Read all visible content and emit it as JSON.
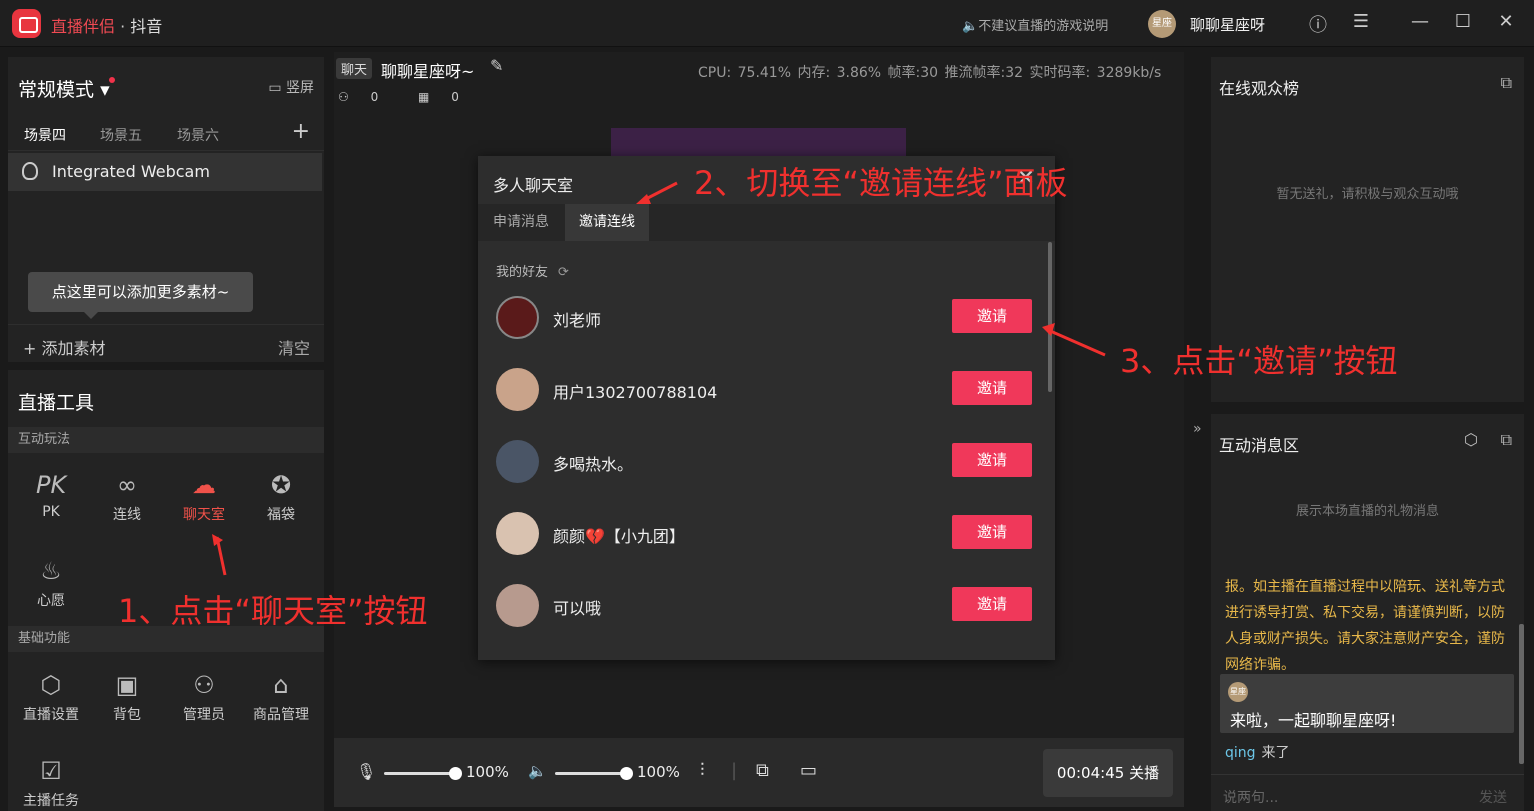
{
  "titlebar": {
    "app_brand": "直播伴侣",
    "app_sep": "·",
    "app_platform": "抖音",
    "game_hint": "不建议直播的游戏说明",
    "user_avatar_text": "星座",
    "username": "聊聊星座呀"
  },
  "mode": {
    "title": "常规模式",
    "vertical_label": "竖屏",
    "scenes": [
      "场景四",
      "场景五",
      "场景六"
    ],
    "source": "Integrated Webcam",
    "tooltip": "点这里可以添加更多素材~",
    "add_material": "添加素材",
    "clear": "清空"
  },
  "tools": {
    "title": "直播工具",
    "section_interactive": "互动玩法",
    "interactive": [
      {
        "label": "PK",
        "icon": "pk-icon"
      },
      {
        "label": "连线",
        "icon": "link-icon"
      },
      {
        "label": "聊天室",
        "icon": "chatroom-icon"
      },
      {
        "label": "福袋",
        "icon": "lucky-bag-icon"
      },
      {
        "label": "心愿",
        "icon": "wish-icon"
      }
    ],
    "section_basic": "基础功能",
    "basic": [
      {
        "label": "直播设置",
        "icon": "settings-icon"
      },
      {
        "label": "背包",
        "icon": "backpack-icon"
      },
      {
        "label": "管理员",
        "icon": "admin-icon"
      },
      {
        "label": "商品管理",
        "icon": "shop-icon"
      },
      {
        "label": "主播任务",
        "icon": "task-icon"
      }
    ]
  },
  "stream": {
    "tag": "聊天",
    "title": "聊聊星座呀~",
    "stats": "CPU: 75.41%   内存: 3.86%   帧率:30   推流帧率:32   实时码率: 3289kb/s",
    "viewers": "0",
    "gifts": "0"
  },
  "controls": {
    "mic_volume": "100%",
    "speaker_volume": "100%",
    "timer": "00:04:45",
    "stop_label": "关播"
  },
  "dialog": {
    "title": "多人聊天室",
    "tabs": [
      "申请消息",
      "邀请连线"
    ],
    "friends_header": "我的好友",
    "invite_label": "邀请",
    "friends": [
      {
        "name": "刘老师",
        "color": "#5a1a1a"
      },
      {
        "name": "用户1302700788104",
        "color": "#c9a38a"
      },
      {
        "name": "多喝热水。",
        "color": "#4a5566"
      },
      {
        "name": "颜颜💔【小九团】",
        "color": "#d9c2b0"
      },
      {
        "name": "可以哦",
        "color": "#b79a8e"
      }
    ]
  },
  "right": {
    "audience_title": "在线观众榜",
    "audience_empty": "暂无送礼，请积极与观众互动哦",
    "messages_title": "互动消息区",
    "messages_empty": "展示本场直播的礼物消息",
    "notice": "报。如主播在直播过程中以陪玩、送礼等方式进行诱导打赏、私下交易，请谨慎判断，以防人身或财产损失。请大家注意财产安全，谨防网络诈骗。",
    "host_message": "来啦，一起聊聊星座呀!",
    "join_name": "qing",
    "join_verb": "来了",
    "input_placeholder": "说两句...",
    "send": "发送"
  },
  "annotations": {
    "step1": "1、点击“聊天室”按钮",
    "step2": "2、切换至“邀请连线”面板",
    "step3": "3、点击“邀请”按钮"
  },
  "colors": {
    "accent": "#f0385a",
    "annotation": "#f0302e"
  }
}
